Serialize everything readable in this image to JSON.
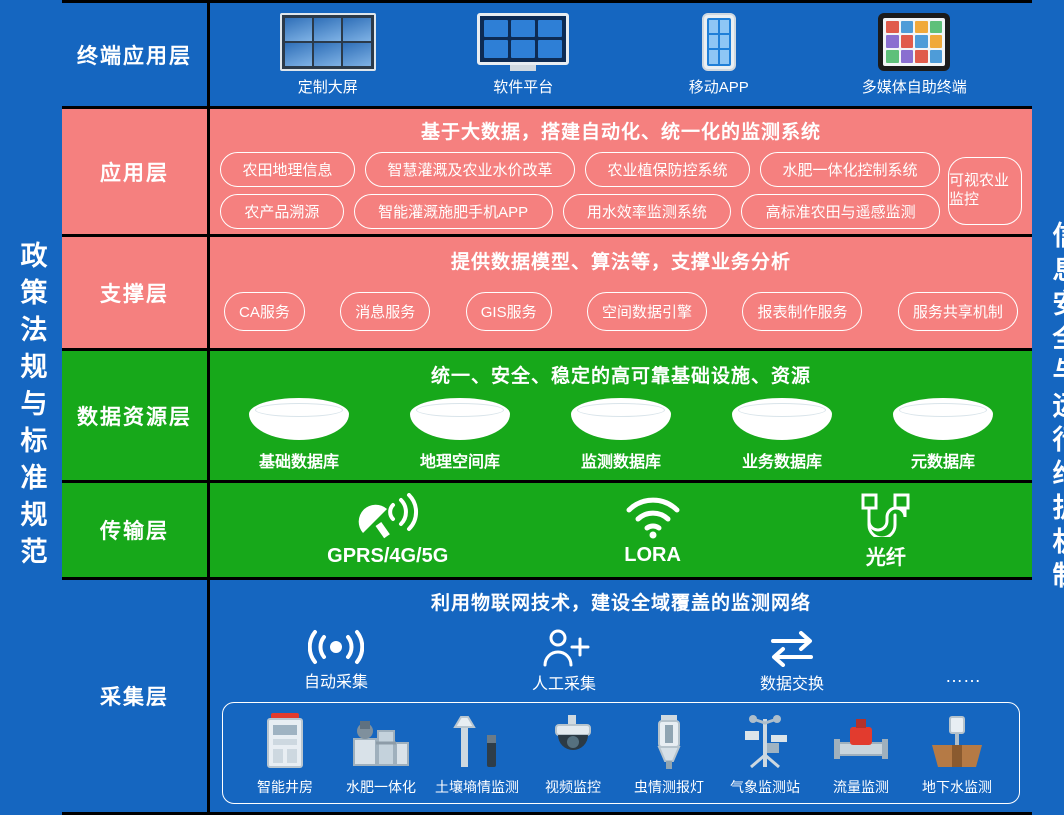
{
  "left_pillar": {
    "text": "政策法规与标准规范"
  },
  "right_pillar": {
    "text": "信息安全与运行维护机制"
  },
  "layers": {
    "terminal": {
      "label": "终端应用层",
      "items": [
        {
          "caption": "定制大屏",
          "icon": "video-wall-icon"
        },
        {
          "caption": "软件平台",
          "icon": "desktop-monitor-icon"
        },
        {
          "caption": "移动APP",
          "icon": "smartphone-icon"
        },
        {
          "caption": "多媒体自助终端",
          "icon": "kiosk-terminal-icon"
        }
      ]
    },
    "application": {
      "label": "应用层",
      "banner": "基于大数据，搭建自动化、统一化的监测系统",
      "row1": [
        "农田地理信息",
        "智慧灌溉及农业水价改革",
        "农业植保防控系统",
        "水肥一体化控制系统"
      ],
      "row2": [
        "农产品溯源",
        "智能灌溉施肥手机APP",
        "用水效率监测系统",
        "高标准农田与遥感监测"
      ],
      "tall": "可视农业监控"
    },
    "support": {
      "label": "支撑层",
      "banner": "提供数据模型、算法等，支撑业务分析",
      "items": [
        "CA服务",
        "消息服务",
        "GIS服务",
        "空间数据引擎",
        "报表制作服务",
        "服务共享机制"
      ]
    },
    "data_resource": {
      "label": "数据资源层",
      "banner": "统一、安全、稳定的高可靠基础设施、资源",
      "items": [
        "基础数据库",
        "地理空间库",
        "监测数据库",
        "业务数据库",
        "元数据库"
      ]
    },
    "transport": {
      "label": "传输层",
      "items": [
        {
          "caption": "GPRS/4G/5G",
          "icon": "satellite-dish-icon"
        },
        {
          "caption": "LORA",
          "icon": "wifi-signal-icon"
        },
        {
          "caption": "光纤",
          "icon": "fiber-optic-icon"
        }
      ]
    },
    "collection": {
      "label": "采集层",
      "banner": "利用物联网技术，建设全域覆盖的监测网络",
      "methods": [
        {
          "caption": "自动采集",
          "icon": "broadcast-signal-icon"
        },
        {
          "caption": "人工采集",
          "icon": "person-add-icon"
        },
        {
          "caption": "数据交换",
          "icon": "exchange-arrows-icon"
        }
      ],
      "more": "……",
      "sensors": [
        {
          "caption": "智能井房",
          "icon": "smart-well-cabinet-icon"
        },
        {
          "caption": "水肥一体化",
          "icon": "fertigation-machine-icon"
        },
        {
          "caption": "土壤墒情监测",
          "icon": "soil-moisture-probe-icon"
        },
        {
          "caption": "视频监控",
          "icon": "dome-camera-icon"
        },
        {
          "caption": "虫情测报灯",
          "icon": "insect-trap-lamp-icon"
        },
        {
          "caption": "气象监测站",
          "icon": "weather-station-icon"
        },
        {
          "caption": "流量监测",
          "icon": "flow-meter-icon"
        },
        {
          "caption": "地下水监测",
          "icon": "groundwater-monitor-icon"
        }
      ]
    }
  },
  "colors": {
    "blue": "#1566c0",
    "pink": "#f5807f",
    "green": "#17a81a",
    "background": "#000000",
    "white": "#ffffff"
  }
}
